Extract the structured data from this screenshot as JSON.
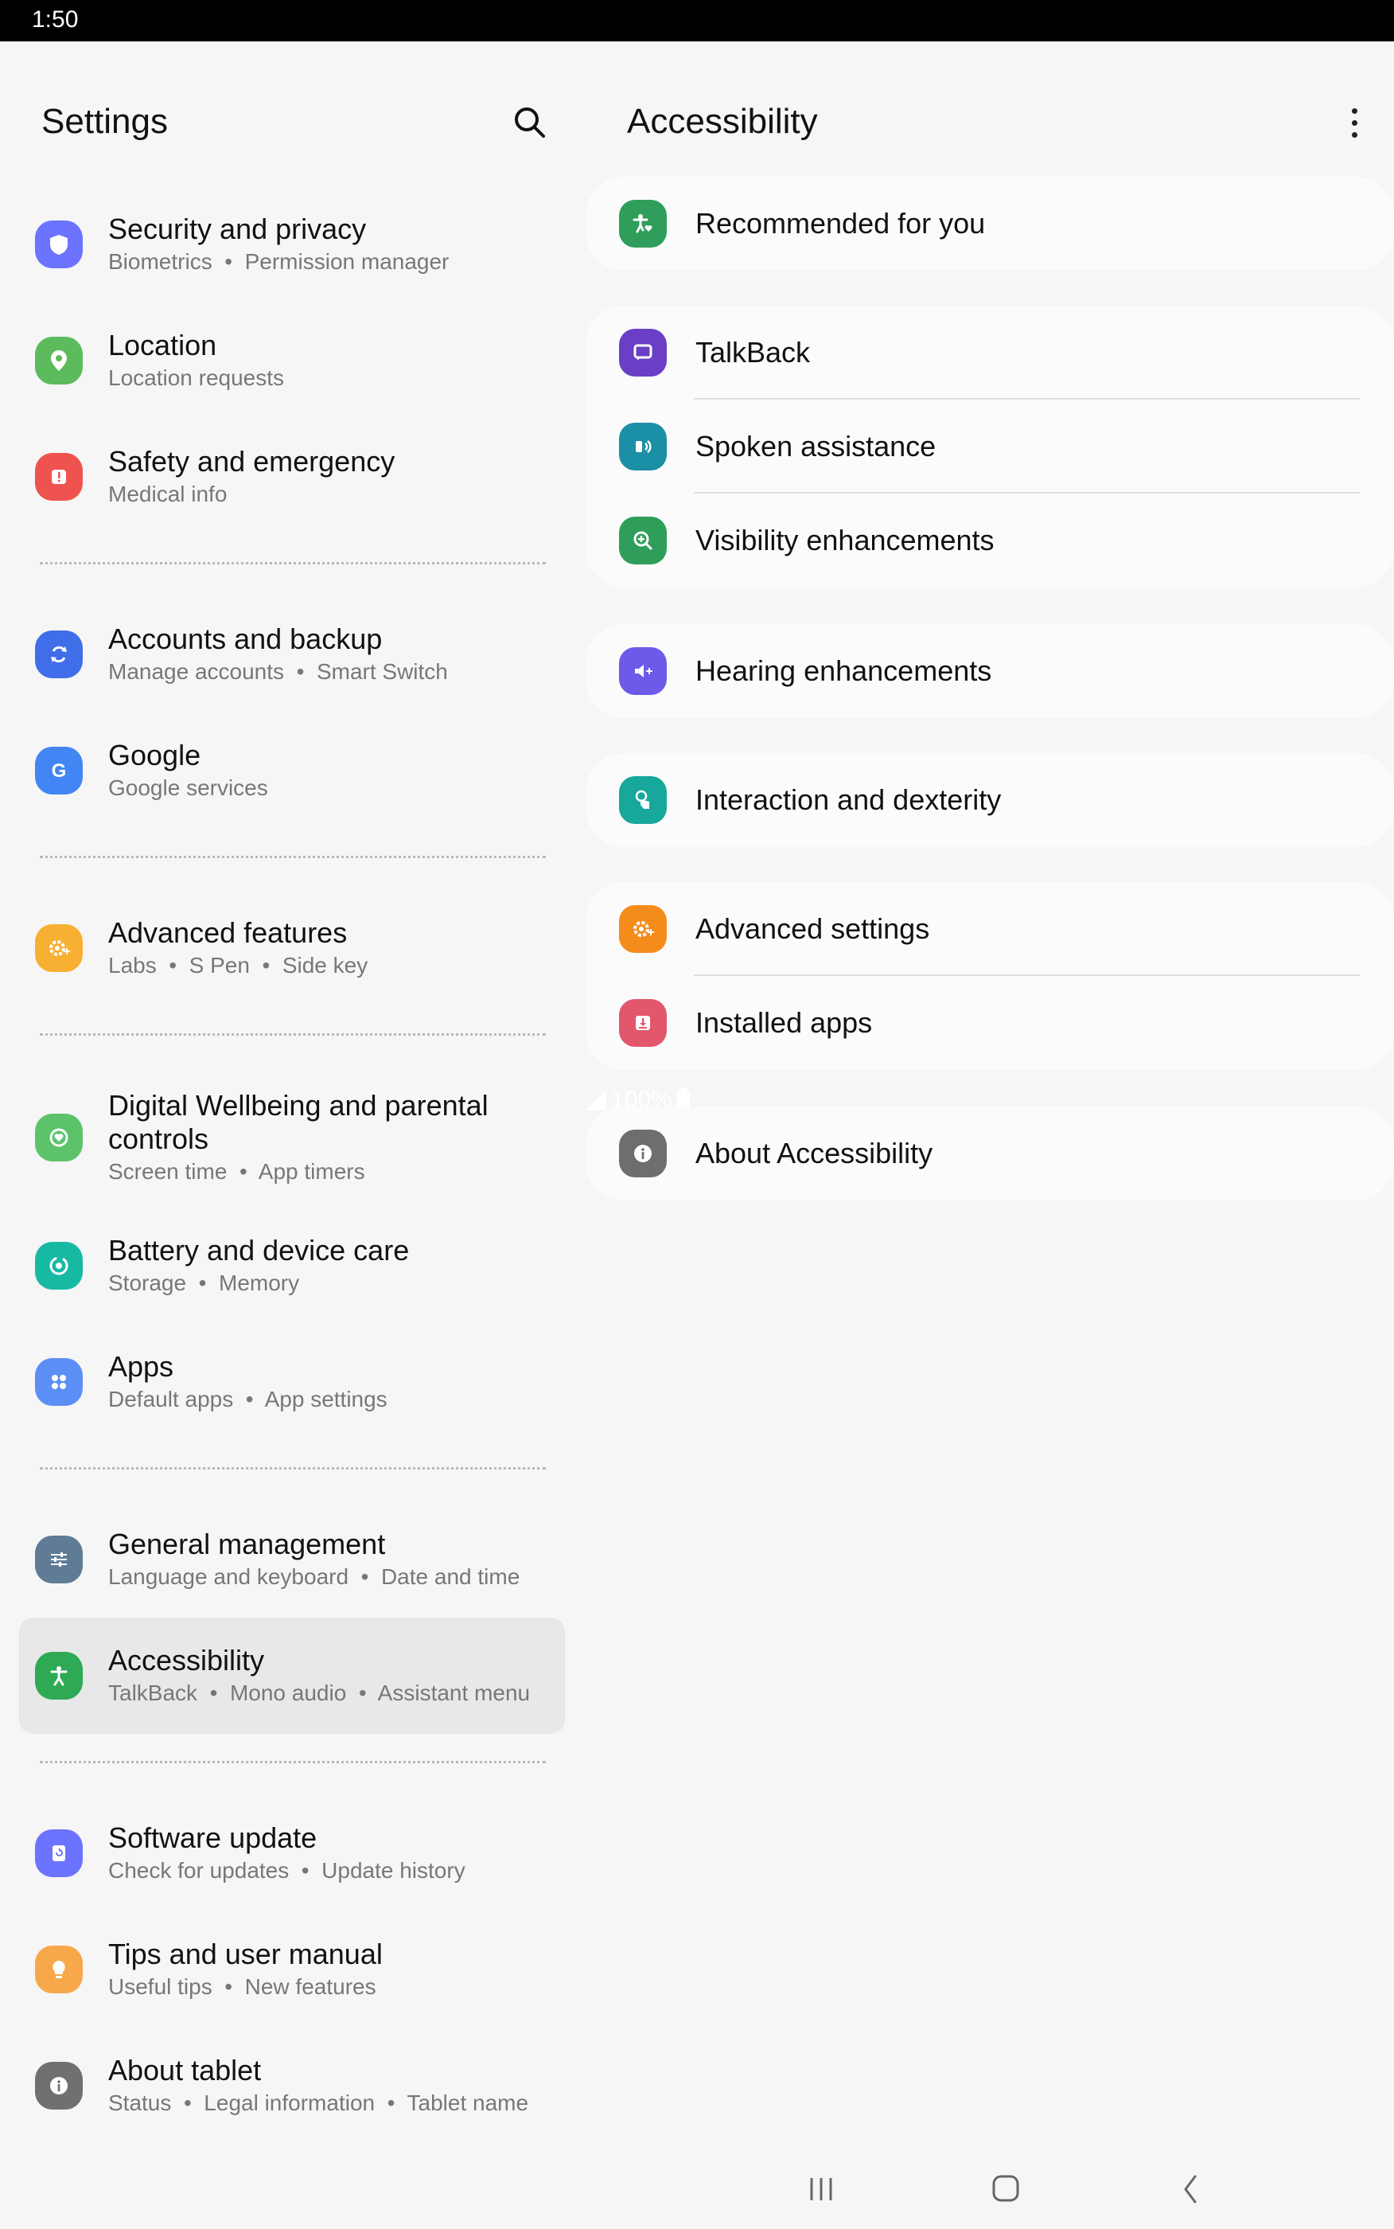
{
  "status": {
    "time": "1:50",
    "battery": "100%"
  },
  "settings": {
    "title": "Settings",
    "groups": [
      [
        {
          "title": "Security and privacy",
          "subtitle": "Biometrics  •  Permission manager",
          "icon": "shield-icon",
          "color": "#6b73ff"
        },
        {
          "title": "Location",
          "subtitle": "Location requests",
          "icon": "location-pin-icon",
          "color": "#5cbb5c"
        },
        {
          "title": "Safety and emergency",
          "subtitle": "Medical info",
          "icon": "alert-icon",
          "color": "#ef5350"
        }
      ],
      [
        {
          "title": "Accounts and backup",
          "subtitle": "Manage accounts  •  Smart Switch",
          "icon": "sync-icon",
          "color": "#3f6ee8"
        },
        {
          "title": "Google",
          "subtitle": "Google services",
          "icon": "google-icon",
          "color": "#4285f4"
        }
      ],
      [
        {
          "title": "Advanced features",
          "subtitle": "Labs  •  S Pen  •  Side key",
          "icon": "gear-plus-icon",
          "color": "#f7b032"
        }
      ],
      [
        {
          "title": "Digital Wellbeing and parental controls",
          "subtitle": "Screen time  •  App timers",
          "icon": "wellbeing-icon",
          "color": "#5cc36b"
        },
        {
          "title": "Battery and device care",
          "subtitle": "Storage  •  Memory",
          "icon": "device-care-icon",
          "color": "#17b9a3"
        },
        {
          "title": "Apps",
          "subtitle": "Default apps  •  App settings",
          "icon": "apps-grid-icon",
          "color": "#5c8ff5"
        }
      ],
      [
        {
          "title": "General management",
          "subtitle": "Language and keyboard  •  Date and time",
          "icon": "sliders-icon",
          "color": "#5f7b96"
        },
        {
          "title": "Accessibility",
          "subtitle": "TalkBack  •  Mono audio  •  Assistant menu",
          "icon": "accessibility-icon",
          "color": "#2eaa55",
          "selected": true
        }
      ],
      [
        {
          "title": "Software update",
          "subtitle": "Check for updates  •  Update history",
          "icon": "software-update-icon",
          "color": "#6b73ff"
        },
        {
          "title": "Tips and user manual",
          "subtitle": "Useful tips  •  New features",
          "icon": "lightbulb-icon",
          "color": "#f7a84a"
        },
        {
          "title": "About tablet",
          "subtitle": "Status  •  Legal information  •  Tablet name",
          "icon": "info-icon",
          "color": "#707070"
        }
      ]
    ]
  },
  "accessibility": {
    "title": "Accessibility",
    "cards": [
      [
        {
          "label": "Recommended for you",
          "icon": "accessibility-heart-icon",
          "color": "#2e9e5a"
        }
      ],
      [
        {
          "label": "TalkBack",
          "icon": "talkback-icon",
          "color": "#6a3fc6"
        },
        {
          "label": "Spoken assistance",
          "icon": "spoken-assistance-icon",
          "color": "#1b8fa6"
        },
        {
          "label": "Visibility enhancements",
          "icon": "magnifier-plus-icon",
          "color": "#2e9e5a"
        }
      ],
      [
        {
          "label": "Hearing enhancements",
          "icon": "hearing-icon",
          "color": "#6b5be8"
        }
      ],
      [
        {
          "label": "Interaction and dexterity",
          "icon": "touch-icon",
          "color": "#17a89b"
        }
      ],
      [
        {
          "label": "Advanced settings",
          "icon": "gear-plus-icon",
          "color": "#f48c1b"
        },
        {
          "label": "Installed apps",
          "icon": "download-icon",
          "color": "#e2576c"
        }
      ],
      [
        {
          "label": "About Accessibility",
          "icon": "info-icon",
          "color": "#6e6e6e"
        }
      ]
    ]
  }
}
